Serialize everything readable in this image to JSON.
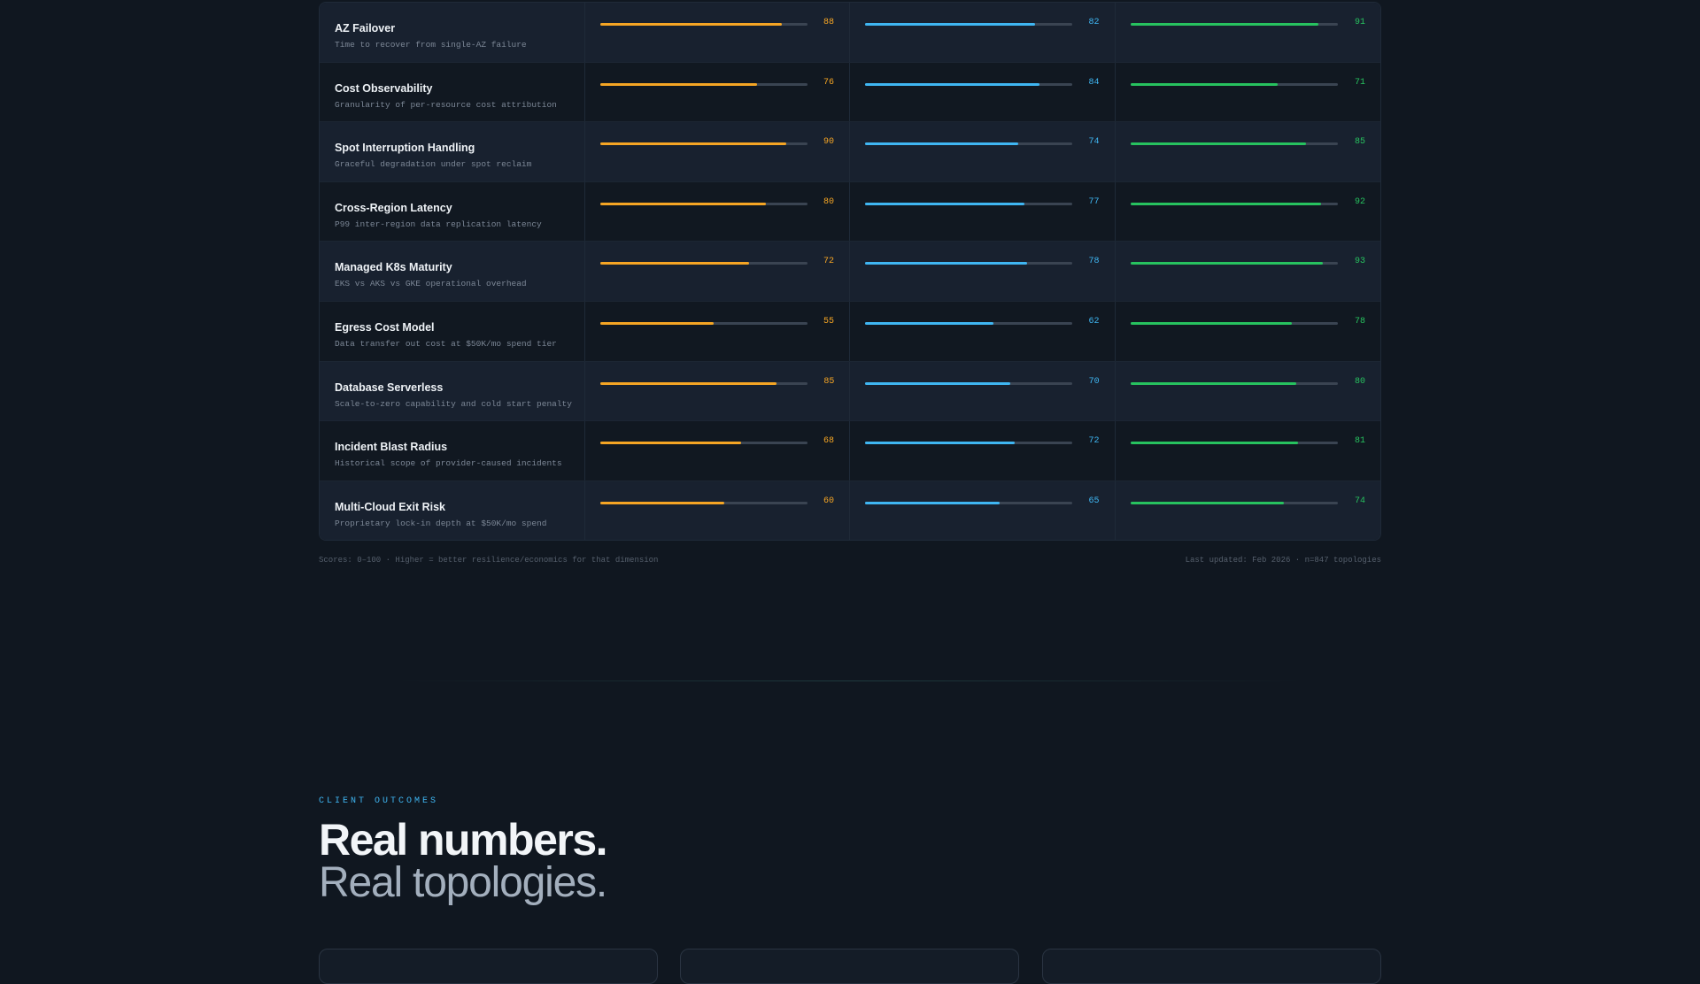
{
  "colors": {
    "series_a": "#f5a524",
    "series_b": "#3fb6f2",
    "series_c": "#27c25f",
    "background": "#101720"
  },
  "rows": [
    {
      "title": "AZ Failover",
      "desc": "Time to recover from single-AZ failure",
      "scores": [
        88,
        82,
        91
      ]
    },
    {
      "title": "Cost Observability",
      "desc": "Granularity of per-resource cost attribution",
      "scores": [
        76,
        84,
        71
      ]
    },
    {
      "title": "Spot Interruption Handling",
      "desc": "Graceful degradation under spot reclaim",
      "scores": [
        90,
        74,
        85
      ]
    },
    {
      "title": "Cross-Region Latency",
      "desc": "P99 inter-region data replication latency",
      "scores": [
        80,
        77,
        92
      ]
    },
    {
      "title": "Managed K8s Maturity",
      "desc": "EKS vs AKS vs GKE operational overhead",
      "scores": [
        72,
        78,
        93
      ]
    },
    {
      "title": "Egress Cost Model",
      "desc": "Data transfer out cost at $50K/mo spend tier",
      "scores": [
        55,
        62,
        78
      ]
    },
    {
      "title": "Database Serverless",
      "desc": "Scale-to-zero capability and cold start penalty",
      "scores": [
        85,
        70,
        80
      ]
    },
    {
      "title": "Incident Blast Radius",
      "desc": "Historical scope of provider-caused incidents",
      "scores": [
        68,
        72,
        81
      ]
    },
    {
      "title": "Multi-Cloud Exit Risk",
      "desc": "Proprietary lock-in depth at $50K/mo spend",
      "scores": [
        60,
        65,
        74
      ]
    }
  ],
  "footer": {
    "left": "Scores: 0–100 · Higher = better resilience/economics for that dimension",
    "right": "Last updated: Feb 2026 · n=847 topologies"
  },
  "outcomes": {
    "eyebrow": "CLIENT OUTCOMES",
    "headline": "Real numbers.",
    "subheadline": "Real topologies."
  }
}
